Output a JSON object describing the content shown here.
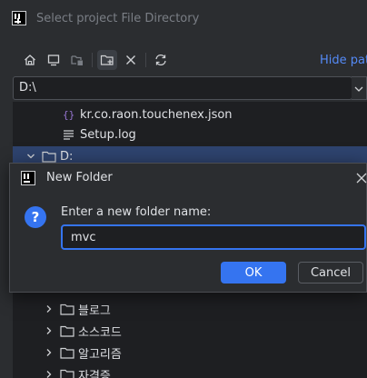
{
  "window": {
    "title": "Select project File Directory"
  },
  "toolbar": {
    "buttons": [
      "home-icon",
      "desktop-icon",
      "project-icon",
      "new-folder-icon",
      "delete-icon",
      "refresh-icon"
    ],
    "hide_path_label": "Hide pat"
  },
  "path": {
    "value": "D:\\"
  },
  "tree": {
    "rows": [
      {
        "label": "kr.co.raon.touchenex.json",
        "icon": "json-file-icon"
      },
      {
        "label": "Setup.log",
        "icon": "text-file-icon"
      },
      {
        "label": "D:",
        "icon": "folder-icon",
        "expanded": true,
        "selected": true
      },
      {
        "label": "블로그",
        "icon": "folder-icon"
      },
      {
        "label": "소스코드",
        "icon": "folder-icon"
      },
      {
        "label": "알고리즘",
        "icon": "folder-icon"
      },
      {
        "label": "자격증",
        "icon": "folder-icon"
      }
    ]
  },
  "dialog": {
    "title": "New Folder",
    "icon": "question-icon",
    "prompt": "Enter a new folder name:",
    "input_value": "mvc",
    "ok_label": "OK",
    "cancel_label": "Cancel"
  },
  "colors": {
    "accent": "#3574f0",
    "link": "#548af7",
    "background": "#2b2d30",
    "field": "#1e1f22",
    "selection": "#2e436e"
  }
}
